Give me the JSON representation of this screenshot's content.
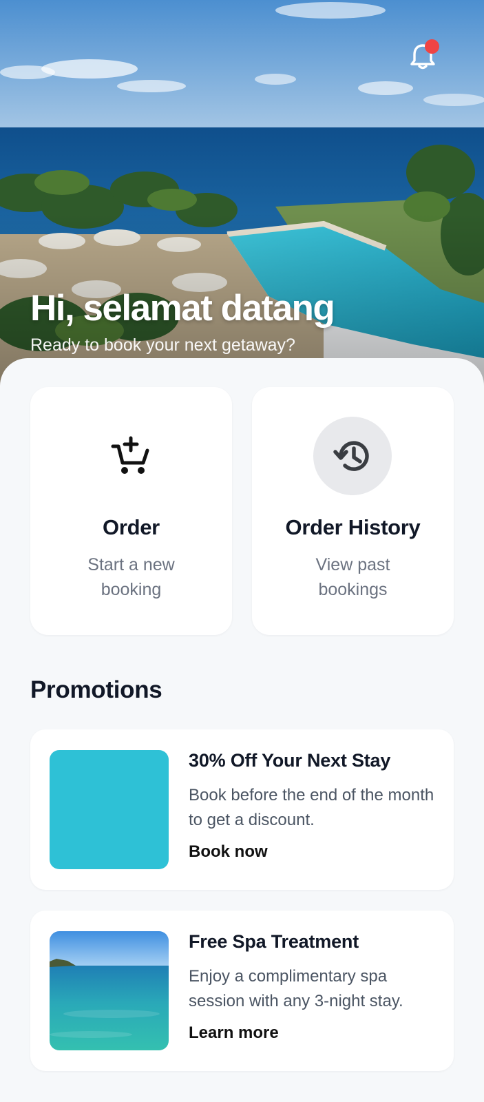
{
  "hero": {
    "title": "Hi, selamat datang",
    "subtitle": "Ready to book your next getaway?"
  },
  "header": {
    "notification_icon": "bell-icon",
    "has_unread_notifications": true
  },
  "actions": [
    {
      "icon": "add-to-cart-icon",
      "title": "Order",
      "description": "Start a new booking"
    },
    {
      "icon": "history-icon",
      "title": "Order History",
      "description": "View past bookings"
    }
  ],
  "promotions": {
    "title": "Promotions",
    "items": [
      {
        "title": "30% Off Your Next Stay",
        "description": "Book before the end of the month to get a discount.",
        "link_label": "Book now"
      },
      {
        "title": "Free Spa Treatment",
        "description": "Enjoy a complimentary spa session with any 3-night stay.",
        "link_label": "Learn more"
      }
    ]
  },
  "colors": {
    "background": "#f6f8fa",
    "card": "#ffffff",
    "heading": "#111827",
    "muted_text": "#6b7280",
    "notification_dot": "#ef4444",
    "promo_teal": "#2ec1d6"
  }
}
